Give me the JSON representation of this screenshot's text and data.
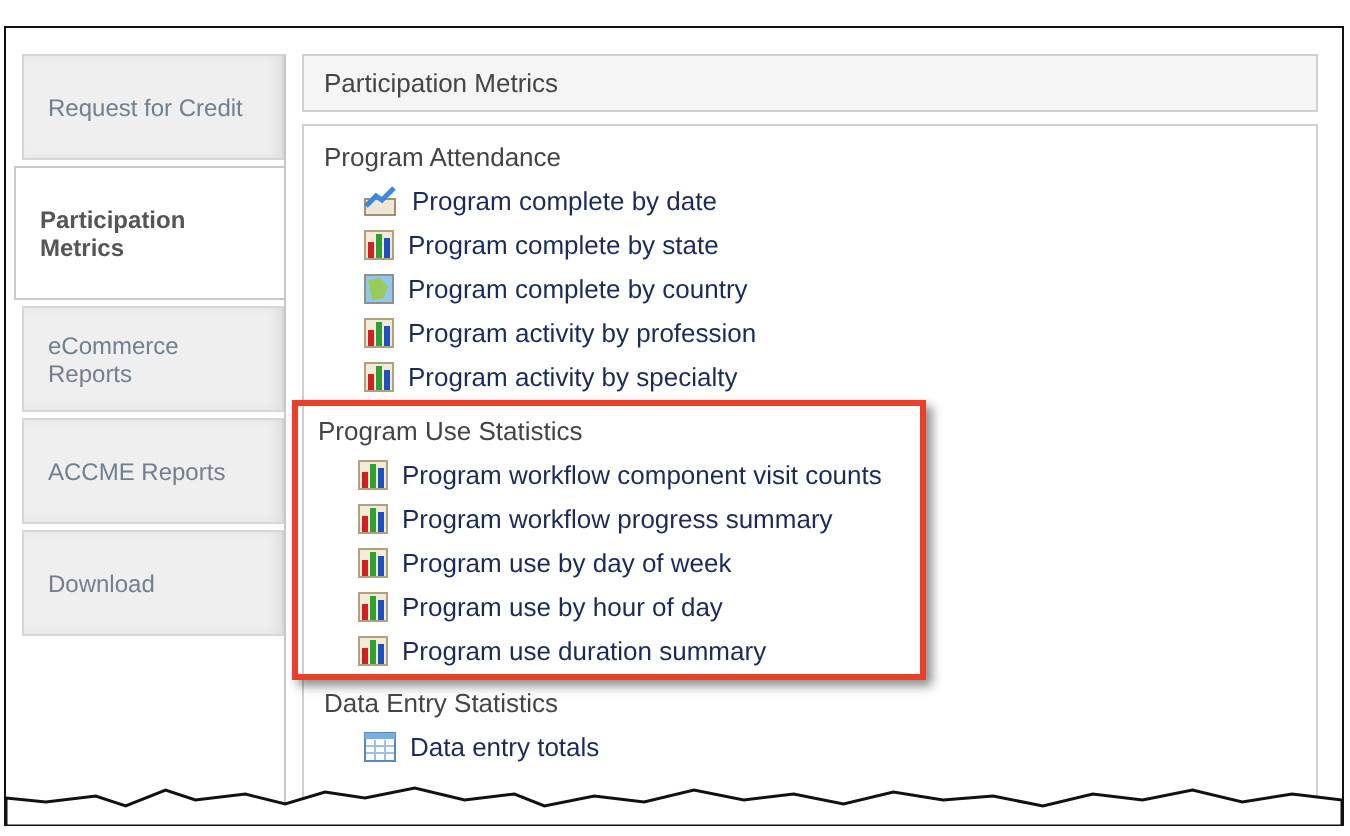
{
  "tabs": [
    {
      "label": "Request for Credit",
      "selected": false
    },
    {
      "label": "Participation Metrics",
      "selected": true
    },
    {
      "label": "eCommerce Reports",
      "selected": false
    },
    {
      "label": "ACCME Reports",
      "selected": false
    },
    {
      "label": "Download",
      "selected": false
    }
  ],
  "panel_title": "Participation Metrics",
  "sections": [
    {
      "heading": "Program Attendance",
      "highlighted": false,
      "items": [
        {
          "label": "Program complete by date",
          "kind": "line"
        },
        {
          "label": "Program complete by state",
          "kind": "bar"
        },
        {
          "label": "Program complete by country",
          "kind": "map"
        },
        {
          "label": "Program activity by profession",
          "kind": "bar"
        },
        {
          "label": "Program activity by specialty",
          "kind": "bar"
        }
      ]
    },
    {
      "heading": "Program Use Statistics",
      "highlighted": true,
      "items": [
        {
          "label": "Program workflow component visit counts",
          "kind": "bar"
        },
        {
          "label": "Program workflow progress summary",
          "kind": "bar"
        },
        {
          "label": "Program use by day of week",
          "kind": "bar"
        },
        {
          "label": "Program use by hour of day",
          "kind": "bar"
        },
        {
          "label": "Program use duration summary",
          "kind": "bar"
        }
      ]
    },
    {
      "heading": "Data Entry Statistics",
      "highlighted": false,
      "items": [
        {
          "label": "Data entry totals",
          "kind": "table"
        }
      ]
    }
  ]
}
